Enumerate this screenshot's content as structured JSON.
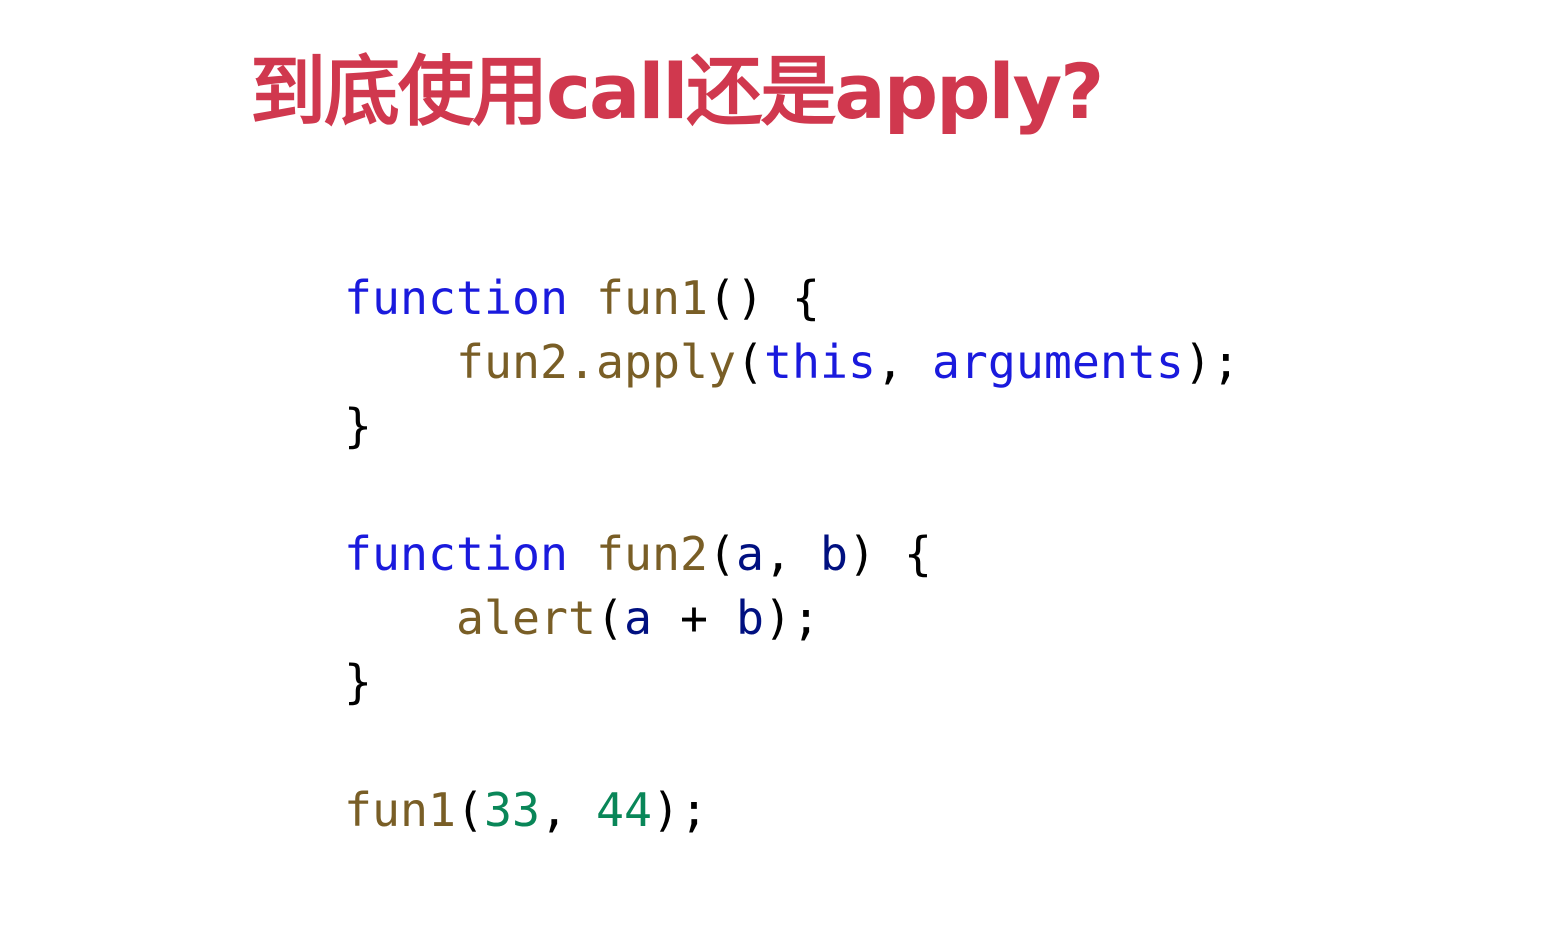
{
  "title": "到底使用call还是apply?",
  "colors": {
    "title": "#d0384e",
    "keyword": "#1a1add",
    "function": "#795e26",
    "variable": "#001080",
    "number": "#098658",
    "plain": "#000000"
  },
  "code": {
    "lines": [
      [
        {
          "t": "function",
          "c": "keyword"
        },
        {
          "t": " ",
          "c": "plain"
        },
        {
          "t": "fun1",
          "c": "function"
        },
        {
          "t": "() {",
          "c": "plain"
        }
      ],
      [
        {
          "t": "    ",
          "c": "plain"
        },
        {
          "t": "fun2.apply",
          "c": "function"
        },
        {
          "t": "(",
          "c": "plain"
        },
        {
          "t": "this",
          "c": "keyword"
        },
        {
          "t": ", ",
          "c": "plain"
        },
        {
          "t": "arguments",
          "c": "keyword"
        },
        {
          "t": ");",
          "c": "plain"
        }
      ],
      [
        {
          "t": "}",
          "c": "plain"
        }
      ],
      [],
      [
        {
          "t": "function",
          "c": "keyword"
        },
        {
          "t": " ",
          "c": "plain"
        },
        {
          "t": "fun2",
          "c": "function"
        },
        {
          "t": "(",
          "c": "plain"
        },
        {
          "t": "a",
          "c": "variable"
        },
        {
          "t": ", ",
          "c": "plain"
        },
        {
          "t": "b",
          "c": "variable"
        },
        {
          "t": ") {",
          "c": "plain"
        }
      ],
      [
        {
          "t": "    ",
          "c": "plain"
        },
        {
          "t": "alert",
          "c": "function"
        },
        {
          "t": "(",
          "c": "plain"
        },
        {
          "t": "a",
          "c": "variable"
        },
        {
          "t": " + ",
          "c": "plain"
        },
        {
          "t": "b",
          "c": "variable"
        },
        {
          "t": ");",
          "c": "plain"
        }
      ],
      [
        {
          "t": "}",
          "c": "plain"
        }
      ],
      [],
      [
        {
          "t": "fun1",
          "c": "function"
        },
        {
          "t": "(",
          "c": "plain"
        },
        {
          "t": "33",
          "c": "number"
        },
        {
          "t": ", ",
          "c": "plain"
        },
        {
          "t": "44",
          "c": "number"
        },
        {
          "t": ");",
          "c": "plain"
        }
      ]
    ]
  }
}
